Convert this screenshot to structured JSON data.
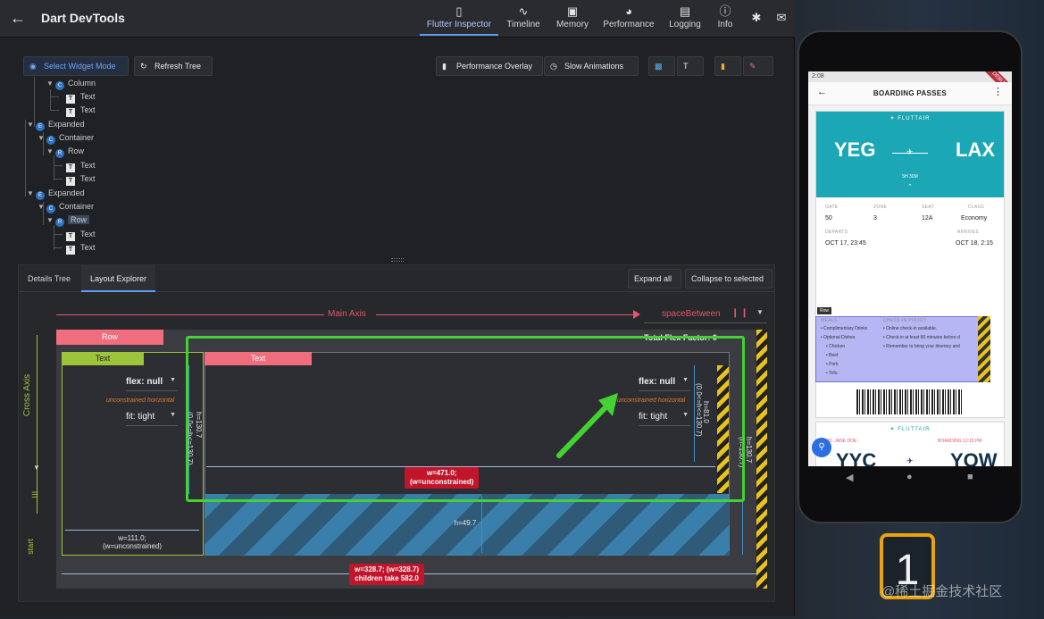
{
  "appbar": {
    "title": "Dart DevTools",
    "tabs": [
      {
        "label": "Flutter Inspector",
        "icon": "phone-icon",
        "active": true
      },
      {
        "label": "Timeline",
        "icon": "pulse-icon"
      },
      {
        "label": "Memory",
        "icon": "box-icon"
      },
      {
        "label": "Performance",
        "icon": "gauge-icon"
      },
      {
        "label": "Logging",
        "icon": "log-icon"
      },
      {
        "label": "Info",
        "icon": "info-icon"
      }
    ],
    "actions": [
      "lightning-icon",
      "feedback-icon"
    ]
  },
  "toolbar": {
    "select_widget_mode": "Select Widget Mode",
    "refresh_tree": "Refresh Tree",
    "performance_overlay": "Performance Overlay",
    "slow_animations": "Slow Animations"
  },
  "tree": {
    "nodes": [
      {
        "label": "Column",
        "kind": "widget",
        "expanded": true
      },
      {
        "label": "Text",
        "kind": "text"
      },
      {
        "label": "Text",
        "kind": "text"
      },
      {
        "label": "Expanded",
        "kind": "widget",
        "expanded": true
      },
      {
        "label": "Container",
        "kind": "widget",
        "expanded": true
      },
      {
        "label": "Row",
        "kind": "widget",
        "expanded": true
      },
      {
        "label": "Text",
        "kind": "text"
      },
      {
        "label": "Text",
        "kind": "text"
      },
      {
        "label": "Expanded",
        "kind": "widget",
        "expanded": true
      },
      {
        "label": "Container",
        "kind": "widget",
        "expanded": true
      },
      {
        "label": "Row",
        "kind": "widget",
        "expanded": true,
        "selected": true
      },
      {
        "label": "Text",
        "kind": "text"
      },
      {
        "label": "Text",
        "kind": "text"
      }
    ]
  },
  "panel": {
    "tabs": [
      "Details Tree",
      "Layout Explorer"
    ],
    "active_tab": "Layout Explorer",
    "expand_all": "Expand all",
    "collapse_to_selected": "Collapse to selected"
  },
  "layout": {
    "main_axis_label": "Main Axis",
    "main_axis_alignment": "spaceBetween",
    "cross_axis_label": "Cross Axis",
    "cross_axis_alignment": "start",
    "row_label": "Row",
    "total_flex_factor": "Total Flex Factor: 0",
    "child1": {
      "label": "Text",
      "flex": "flex: null",
      "note": "unconstrained horizontal",
      "fit": "fit: tight",
      "height_dim": "h=130.7",
      "height_constraint": "(0.0<=h<=130.7)",
      "width_dim": "w=111.0;",
      "width_constraint": "(w=unconstrained)"
    },
    "child2": {
      "label": "Text",
      "flex": "flex: null",
      "note": "unconstrained horizontal",
      "fit": "fit: tight",
      "height_dim": "h=81.0",
      "height_constraint": "(0.0<=h<=130.7)",
      "width_dim": "w=471.0;",
      "width_constraint": "(w=unconstrained)",
      "space_dim": "h=49.7"
    },
    "row_height_dim": "h=130.7",
    "row_height_constraint": "(h=130.7)",
    "row_width_dim": "w=328.7; (w=328.7)",
    "children_take": "children take 582.0"
  },
  "phone": {
    "status_time": "2:08",
    "debug_banner": "DEBUG",
    "title": "BOARDING PASSES",
    "airline": "FLUTTAIR",
    "card1": {
      "origin": "YEG",
      "destination": "LAX",
      "duration": "5H 30M",
      "fields": [
        {
          "label": "GATE",
          "value": "50"
        },
        {
          "label": "ZONE",
          "value": "3"
        },
        {
          "label": "SEAT",
          "value": "12A"
        },
        {
          "label": "CLASS",
          "value": "Economy"
        }
      ],
      "departs_label": "DEPARTS",
      "departs": "OCT 17, 23:45",
      "arrives_label": "ARRIVES",
      "arrives": "OCT 18, 2:15",
      "row_tag": "Row",
      "meals_head": "MEALS",
      "checkin_head": "CHECK-IN POLICY",
      "meals": [
        "• Complimentary Drinks",
        "• Optional Dishes",
        "• Chicken",
        "• Beef",
        "• Pork",
        "• Tofu"
      ],
      "policy": [
        "• Online check-in available.",
        "• Check-in at least 80 minutes before d",
        "• Remember to bring your itinerary and"
      ]
    },
    "card2": {
      "passenger": "MS. JANE DOE",
      "boarding": "BOARDING 12:15 PM",
      "origin": "YYC",
      "destination": "YOW"
    }
  },
  "overlay_badge": "1",
  "watermark": "@稀土掘金技术社区"
}
